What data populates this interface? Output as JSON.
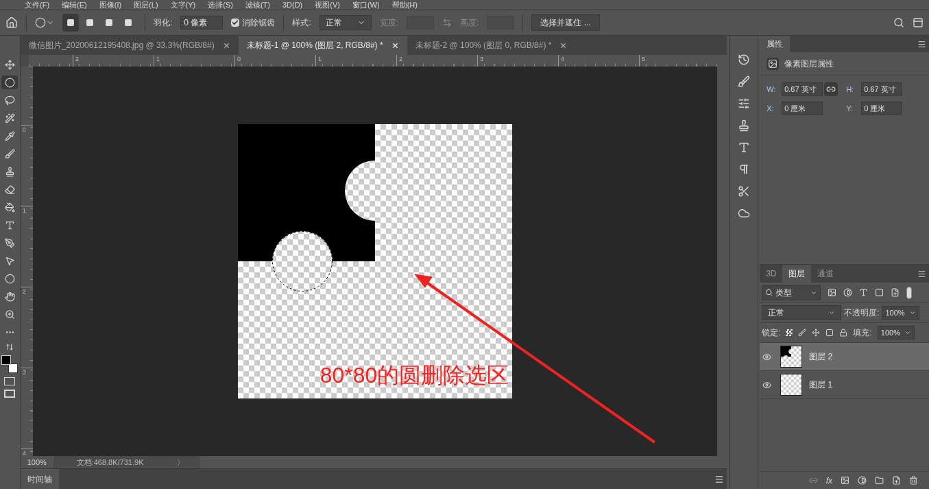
{
  "menu_bar": [
    "文件(F)",
    "编辑(E)",
    "图像(I)",
    "图层(L)",
    "文字(Y)",
    "选择(S)",
    "滤镜(T)",
    "3D(D)",
    "视图(V)",
    "窗口(W)",
    "帮助(H)"
  ],
  "options_bar": {
    "selection_modes": [
      {
        "selected": true
      },
      {
        "selected": false
      },
      {
        "selected": false
      },
      {
        "selected": false
      }
    ],
    "feather_label": "羽化:",
    "feather_value": "0 像素",
    "antialias": {
      "label": "消除锯齿",
      "checked": true
    },
    "style_label": "样式:",
    "style_value": "正常",
    "width_label": "宽度:",
    "height_label": "高度:",
    "select_mask_button": "选择并遮住 ..."
  },
  "tabs": [
    {
      "label": "微信图片_20200612195408.jpg @ 33.3%(RGB/8#)",
      "selected": false
    },
    {
      "label": "未标题-1 @ 100% (图层 2, RGB/8#) *",
      "selected": true
    },
    {
      "label": "未标题-2 @ 100% (图层 0, RGB/8#) *",
      "selected": false
    }
  ],
  "rulers": {
    "horizontal": [
      "2",
      "1",
      "0",
      "1",
      "2",
      "3",
      "4",
      "5"
    ],
    "vertical": [
      "0",
      "1",
      "2",
      "3",
      "4"
    ]
  },
  "tools": [
    {
      "kind": "move",
      "selected": false
    },
    {
      "kind": "marquee",
      "selected": true
    },
    {
      "kind": "lasso",
      "selected": false
    },
    {
      "kind": "quick",
      "selected": false
    },
    {
      "kind": "eyedropper",
      "selected": false
    },
    {
      "kind": "brush",
      "selected": false
    },
    {
      "kind": "stamp",
      "selected": false
    },
    {
      "kind": "eraser",
      "selected": false
    },
    {
      "kind": "bucket",
      "selected": false
    },
    {
      "kind": "type",
      "selected": false
    },
    {
      "kind": "pen",
      "selected": false
    },
    {
      "kind": "pointer",
      "selected": false
    },
    {
      "kind": "ellipse",
      "selected": false
    },
    {
      "kind": "hand",
      "selected": false
    },
    {
      "kind": "zoom",
      "selected": false
    },
    {
      "kind": "more",
      "selected": false
    }
  ],
  "annotation": {
    "text": "80*80的圆删除选区"
  },
  "status_bar": {
    "zoom": "100%",
    "doc_info": "文档:468.8K/731.9K",
    "arrow": "〉"
  },
  "timeline": {
    "label": "时间轴"
  },
  "properties_panel": {
    "tab": "属性",
    "header": "像素图层属性",
    "fields": [
      {
        "label": "W:",
        "value": "0.67 英寸"
      },
      {
        "label": "H:",
        "value": "0.67 英寸"
      },
      {
        "label": "X:",
        "value": "0 厘米"
      },
      {
        "label": "Y:",
        "value": "0 厘米"
      }
    ]
  },
  "layers_panel": {
    "tabs": [
      {
        "label": "3D",
        "selected": false
      },
      {
        "label": "图层",
        "selected": true
      },
      {
        "label": "通道",
        "selected": false
      }
    ],
    "filter": "类型",
    "blend_mode": "正常",
    "opacity_label": "不透明度:",
    "opacity": "100%",
    "lock_label": "锁定:",
    "fill_label": "填充:",
    "fill": "100%",
    "style_button": "fx",
    "layers": [
      {
        "name": "图层 2",
        "selected": true,
        "visible": true,
        "kind": "shape"
      },
      {
        "name": "图层 1",
        "selected": false,
        "visible": true,
        "kind": "empty"
      }
    ]
  }
}
